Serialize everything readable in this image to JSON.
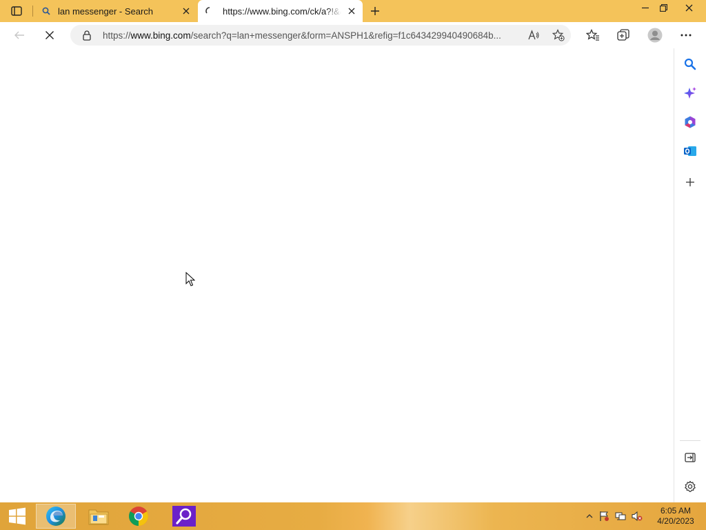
{
  "browser": {
    "tabs": [
      {
        "title": "lan messenger - Search",
        "favicon": "search-icon",
        "active": false
      },
      {
        "title": "https://www.bing.com/ck/a?!&&p=",
        "favicon": "loading-spinner-icon",
        "active": true
      }
    ],
    "address": {
      "url_prefix": "https://",
      "url_host": "www.bing.com",
      "url_rest": "/search?q=lan+messenger&form=ANSPH1&refig=f1c643429940490684b..."
    },
    "loading": true
  },
  "colors": {
    "tabstrip": "#f4c35a",
    "accent_blue": "#1a73e8",
    "taskbar": "#e5a63e"
  },
  "sidebar": {
    "items": [
      "search-icon",
      "discover-icon",
      "office-icon",
      "outlook-icon",
      "add-icon",
      "hide-sidebar-icon",
      "settings-icon"
    ]
  },
  "taskbar": {
    "apps": [
      "edge-icon",
      "file-explorer-icon",
      "chrome-icon",
      "search-app-icon"
    ],
    "time": "6:05 AM",
    "date": "4/20/2023"
  }
}
